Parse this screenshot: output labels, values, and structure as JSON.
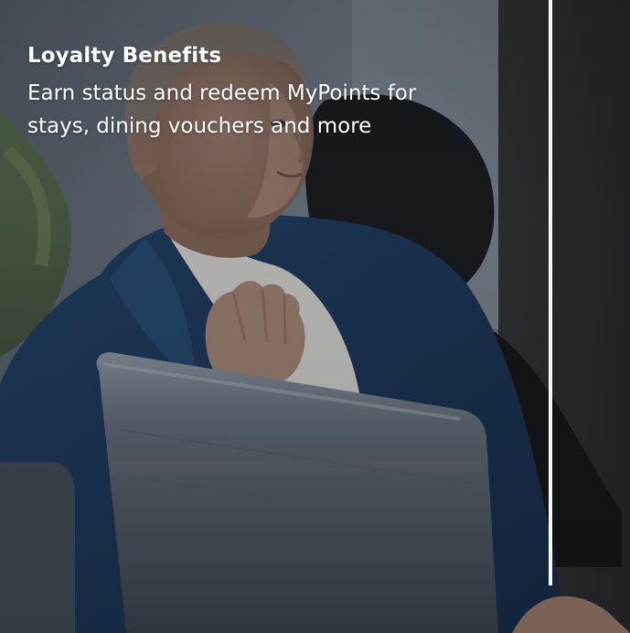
{
  "card": {
    "title": "Loyalty Benefits",
    "description": "Earn status and redeem MyPoints for stays, dining vouchers and more"
  },
  "colors": {
    "text": "#ffffff",
    "divider": "#ffffff",
    "overlay": "#1f252d"
  }
}
